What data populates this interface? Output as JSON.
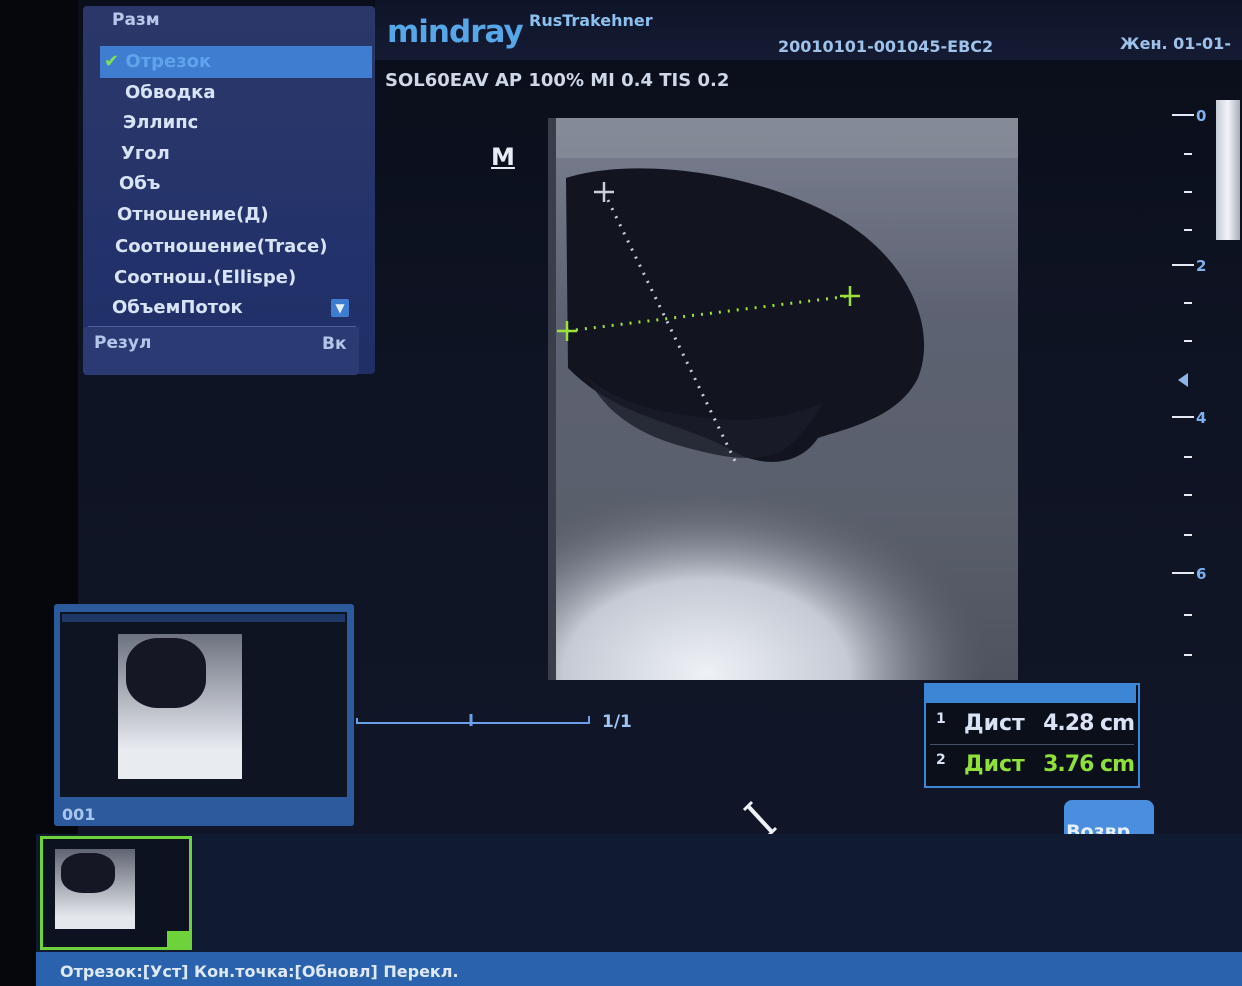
{
  "header": {
    "brand": "mindray",
    "hospital": "RusTrakehner",
    "patient_id": "20010101-001045-EBC2",
    "patient_extra": "Жен. 01-01-",
    "probe_params": "SOL60EAV AP 100% MI 0.4 TIS 0.2"
  },
  "menu": {
    "title": "Разм",
    "items": [
      {
        "label": "Отрезок",
        "selected": true
      },
      {
        "label": "Обводка"
      },
      {
        "label": "Эллипс"
      },
      {
        "label": "Угол"
      },
      {
        "label": "Объ"
      },
      {
        "label": "Отношение(Д)"
      },
      {
        "label": "Соотношение(Trace)"
      },
      {
        "label": "Соотнош.(Ellispe)"
      },
      {
        "label": "ОбъемПоток"
      }
    ],
    "footer_left": "Резул",
    "footer_right": "Вк"
  },
  "image": {
    "marker": "M"
  },
  "depth_scale": {
    "labels": [
      "0",
      "2",
      "4",
      "6"
    ]
  },
  "thumbnail": {
    "label": "001"
  },
  "cine": {
    "frame": "1/1"
  },
  "results": [
    {
      "num": "1",
      "name": "Дист",
      "value": "4.28 cm",
      "color": "#d9e3f6"
    },
    {
      "num": "2",
      "name": "Дист",
      "value": "3.76 cm",
      "color": "#8fe03a"
    }
  ],
  "buttons": {
    "back": "Возвр..."
  },
  "status_bar": {
    "text": "Отрезок:[Уст] Кон.точка:[Обновл] Перекл."
  },
  "colors": {
    "accent": "#3d86d6",
    "caliper_green": "#9be23a",
    "menu_selected": "#3f7dd1"
  }
}
